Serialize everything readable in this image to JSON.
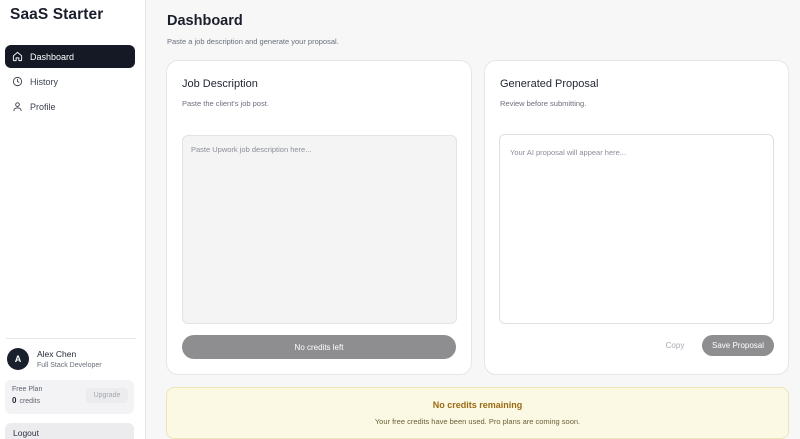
{
  "app": {
    "name": "SaaS Starter"
  },
  "sidebar": {
    "items": [
      {
        "label": "Dashboard",
        "icon": "home-icon",
        "active": true
      },
      {
        "label": "History",
        "icon": "clock-icon",
        "active": false
      },
      {
        "label": "Profile",
        "icon": "user-icon",
        "active": false
      }
    ],
    "user": {
      "initial": "A",
      "name": "Alex Chen",
      "role": "Full Stack Developer"
    },
    "plan": {
      "name": "Free Plan",
      "credits_count": "0",
      "credits_label": "credits",
      "upgrade_label": "Upgrade"
    },
    "logout_label": "Logout"
  },
  "main": {
    "title": "Dashboard",
    "subtitle": "Paste a job description and generate your proposal.",
    "job_card": {
      "title": "Job Description",
      "subtitle": "Paste the client's job post.",
      "placeholder": "Paste Upwork job description here...",
      "button_label": "No credits left"
    },
    "proposal_card": {
      "title": "Generated Proposal",
      "subtitle": "Review before submitting.",
      "placeholder": "Your AI proposal will appear here...",
      "copy_label": "Copy",
      "save_label": "Save Proposal"
    },
    "banner": {
      "title": "No credits remaining",
      "text": "Your free credits have been used. Pro plans are coming soon."
    }
  },
  "colors": {
    "nav_active_bg": "#141925",
    "disabled_button": "#8e8e90",
    "banner_bg": "#fbf8e4",
    "banner_title": "#9a6a12"
  }
}
